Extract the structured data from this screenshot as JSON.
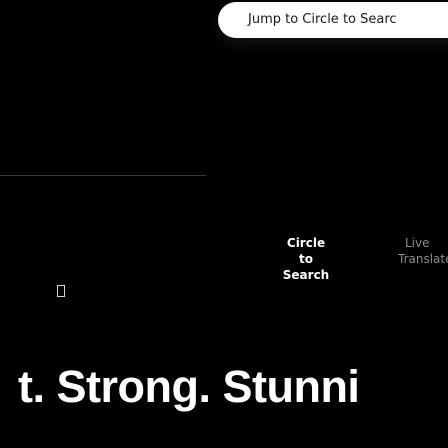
{
  "search_bar": {
    "text": "Jump to Circle to Searc"
  },
  "modes": {
    "selected_line1": "Circle to",
    "selected_line2": "Search",
    "live": "Live",
    "translate": "Translate"
  },
  "headline": {
    "text": "t. Strong. Stunni"
  },
  "colors": {
    "background": "#000000",
    "pill": "#ffffff",
    "selected_text": "#ffffff",
    "muted_text": "#8a8a8a"
  }
}
